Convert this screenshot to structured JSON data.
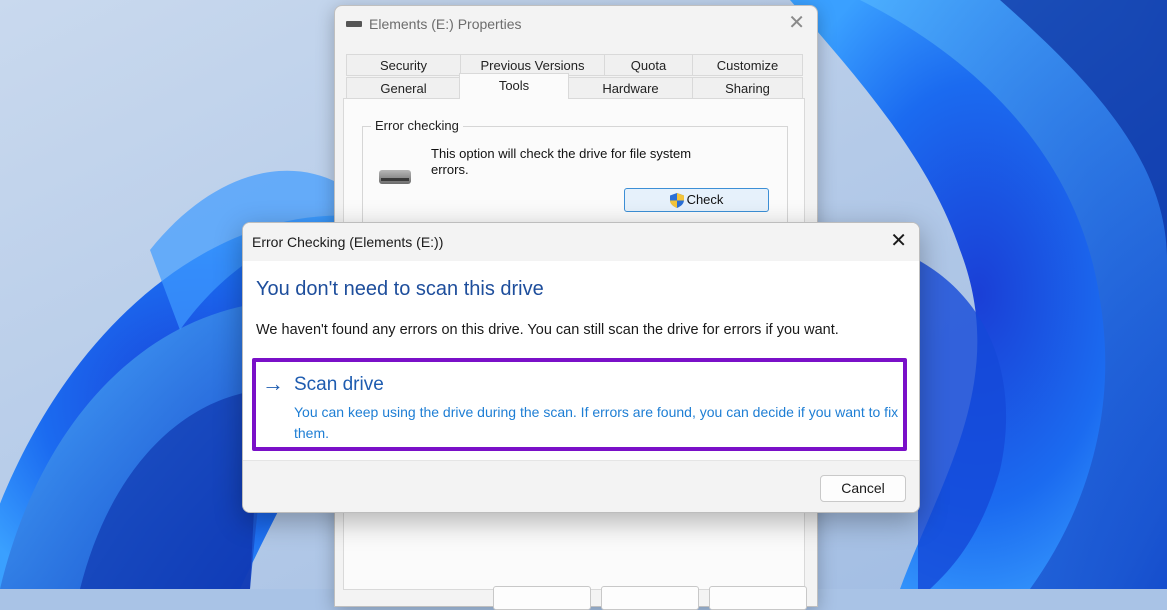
{
  "colors": {
    "accent_purple": "#7a10c8",
    "heading_blue": "#1e4e9c",
    "link_blue": "#1e5cb0"
  },
  "properties_window": {
    "title": "Elements (E:) Properties",
    "close_icon": "close-icon",
    "tabs_row1": [
      "Security",
      "Previous Versions",
      "Quota",
      "Customize"
    ],
    "tabs_row2": [
      "General",
      "Tools",
      "Hardware",
      "Sharing"
    ],
    "active_tab": "Tools",
    "error_checking": {
      "group_label": "Error checking",
      "description": "This option will check the drive for file system errors.",
      "check_button": "Check"
    }
  },
  "error_dialog": {
    "title": "Error Checking (Elements (E:))",
    "heading": "You don't need to scan this drive",
    "message": "We haven't found any errors on this drive. You can still scan the drive for errors if you want.",
    "option": {
      "icon": "arrow-right-icon",
      "title": "Scan drive",
      "description": "You can keep using the drive during the scan. If errors are found, you can decide if you want to fix them."
    },
    "cancel_button": "Cancel"
  }
}
